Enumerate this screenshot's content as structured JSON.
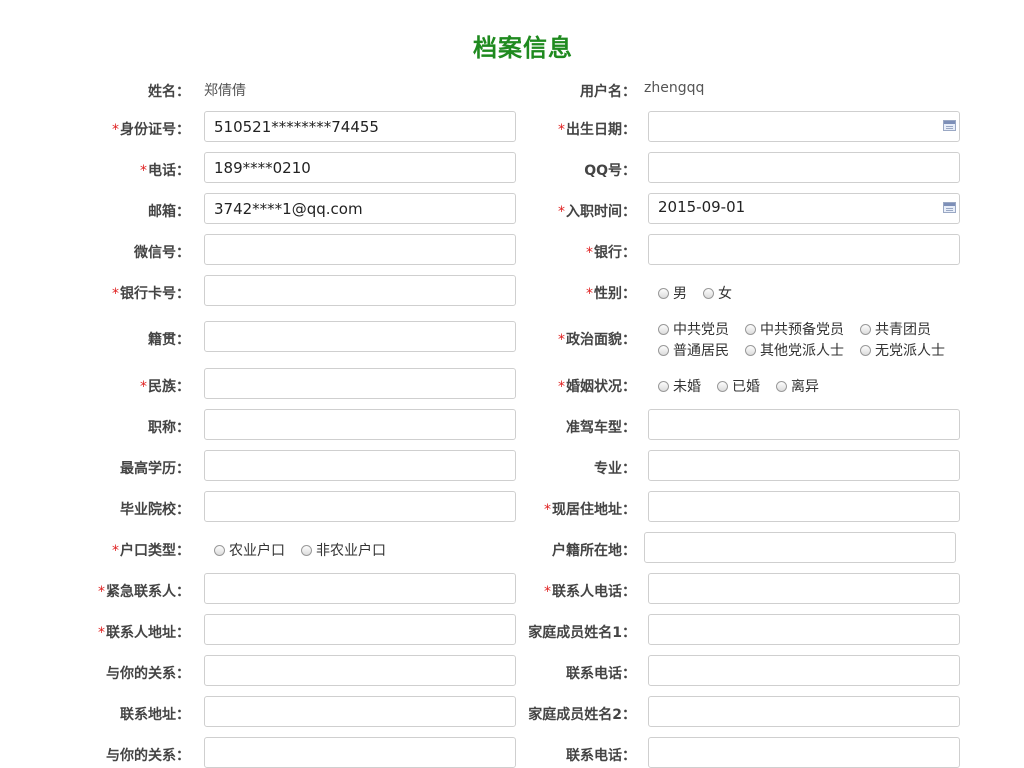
{
  "title": "档案信息",
  "colon": "：",
  "req": "*",
  "name": {
    "label": "姓名",
    "value": "郑倩倩"
  },
  "username": {
    "label": "用户名",
    "value": "zhengqq"
  },
  "idcard": {
    "label": "身份证号",
    "value": "510521********74455"
  },
  "birthday": {
    "label": "出生日期",
    "value": ""
  },
  "phone": {
    "label": "电话",
    "value": "189****0210"
  },
  "qq": {
    "label": "QQ号",
    "value": ""
  },
  "email": {
    "label": "邮箱",
    "value": "3742****1@qq.com"
  },
  "join_date": {
    "label": "入职时间",
    "value": "2015-09-01"
  },
  "wechat": {
    "label": "微信号",
    "value": ""
  },
  "bank": {
    "label": "银行",
    "value": ""
  },
  "bank_card": {
    "label": "银行卡号",
    "value": ""
  },
  "gender": {
    "label": "性别",
    "options": [
      "男",
      "女"
    ]
  },
  "native_place": {
    "label": "籍贯",
    "value": ""
  },
  "political": {
    "label": "政治面貌",
    "options": [
      "中共党员",
      "中共预备党员",
      "共青团员",
      "普通居民",
      "其他党派人士",
      "无党派人士"
    ]
  },
  "ethnicity": {
    "label": "民族",
    "value": ""
  },
  "marital": {
    "label": "婚姻状况",
    "options": [
      "未婚",
      "已婚",
      "离异"
    ]
  },
  "job_title": {
    "label": "职称",
    "value": ""
  },
  "license_type": {
    "label": "准驾车型",
    "value": ""
  },
  "education": {
    "label": "最高学历",
    "value": ""
  },
  "major": {
    "label": "专业",
    "value": ""
  },
  "school": {
    "label": "毕业院校",
    "value": ""
  },
  "address": {
    "label": "现居住地址",
    "value": ""
  },
  "hukou_type": {
    "label": "户口类型",
    "options": [
      "农业户口",
      "非农业户口"
    ]
  },
  "hukou_location": {
    "label": "户籍所在地",
    "value": ""
  },
  "emergency_contact": {
    "label": "紧急联系人",
    "value": ""
  },
  "contact_phone": {
    "label": "联系人电话",
    "value": ""
  },
  "contact_address": {
    "label": "联系人地址",
    "value": ""
  },
  "family1_name": {
    "label": "家庭成员姓名1",
    "value": ""
  },
  "family1_relation": {
    "label": "与你的关系",
    "value": ""
  },
  "family1_phone": {
    "label": "联系电话",
    "value": ""
  },
  "family1_address": {
    "label": "联系地址",
    "value": ""
  },
  "family2_name": {
    "label": "家庭成员姓名2",
    "value": ""
  },
  "family2_relation": {
    "label": "与你的关系",
    "value": ""
  },
  "family2_phone": {
    "label": "联系电话",
    "value": ""
  }
}
